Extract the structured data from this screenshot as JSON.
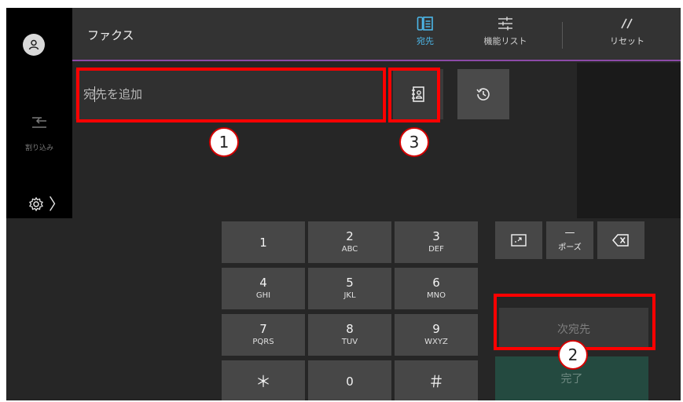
{
  "header": {
    "title": "ファクス",
    "destination_label": "宛先",
    "function_list_label": "機能リスト",
    "reset_label": "リセット"
  },
  "sidebar": {
    "interrupt_label": "割り込み",
    "settings_chevron": "〉"
  },
  "main": {
    "destination_placeholder": "宛先を追加"
  },
  "keypad": {
    "keys": [
      {
        "digit": "1",
        "letters": ""
      },
      {
        "digit": "2",
        "letters": "ABC"
      },
      {
        "digit": "3",
        "letters": "DEF"
      },
      {
        "digit": "4",
        "letters": "GHI"
      },
      {
        "digit": "5",
        "letters": "JKL"
      },
      {
        "digit": "6",
        "letters": "MNO"
      },
      {
        "digit": "7",
        "letters": "PQRS"
      },
      {
        "digit": "8",
        "letters": "TUV"
      },
      {
        "digit": "9",
        "letters": "WXYZ"
      },
      {
        "digit": "＊",
        "letters": ""
      },
      {
        "digit": "0",
        "letters": ""
      },
      {
        "digit": "＃",
        "letters": ""
      }
    ],
    "pause_dash": "—",
    "pause_label": "ポーズ"
  },
  "actions": {
    "next_destination_label": "次宛先",
    "done_label": "完了"
  },
  "annotations": {
    "callout_1": "1",
    "callout_2": "2",
    "callout_3": "3",
    "color": "#ff0000"
  },
  "colors": {
    "accent_blue": "#4cb7e8",
    "header_divider_purple": "#8c4aa8",
    "done_green": "#244a40"
  },
  "icons": [
    "user-icon",
    "interrupt-icon",
    "gear-icon",
    "destination-icon",
    "function-list-icon",
    "reset-icon",
    "address-book-icon",
    "history-icon",
    "delete-icon",
    "dial-mode-icon"
  ]
}
